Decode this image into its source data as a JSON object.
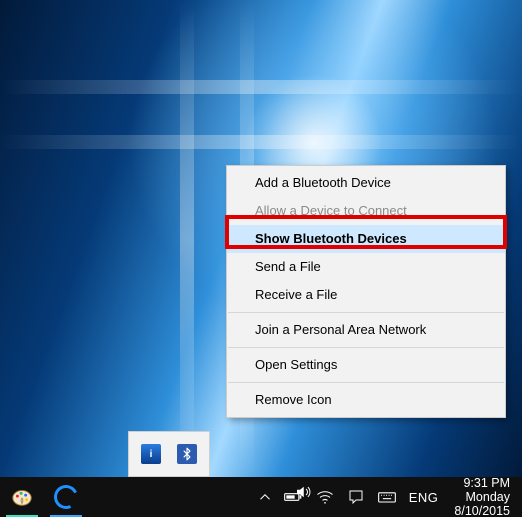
{
  "tray_popup": {
    "items": [
      {
        "name": "intel-graphics-icon",
        "glyph": "i"
      },
      {
        "name": "bluetooth-icon",
        "glyph": "฿"
      }
    ]
  },
  "context_menu": {
    "groups": [
      [
        {
          "label": "Add a Bluetooth Device",
          "disabled": false,
          "highlight": false,
          "name": "menu-add-device"
        },
        {
          "label": "Allow a Device to Connect",
          "disabled": true,
          "highlight": false,
          "name": "menu-allow-connect"
        },
        {
          "label": "Show Bluetooth Devices",
          "disabled": false,
          "highlight": true,
          "name": "menu-show-devices"
        },
        {
          "label": "Send a File",
          "disabled": false,
          "highlight": false,
          "name": "menu-send-file"
        },
        {
          "label": "Receive a File",
          "disabled": false,
          "highlight": false,
          "name": "menu-receive-file"
        }
      ],
      [
        {
          "label": "Join a Personal Area Network",
          "disabled": false,
          "highlight": false,
          "name": "menu-join-pan"
        }
      ],
      [
        {
          "label": "Open Settings",
          "disabled": false,
          "highlight": false,
          "name": "menu-open-settings"
        }
      ],
      [
        {
          "label": "Remove Icon",
          "disabled": false,
          "highlight": false,
          "name": "menu-remove-icon"
        }
      ]
    ]
  },
  "taskbar": {
    "pinned": [
      {
        "name": "paint-app",
        "icon": "paint"
      },
      {
        "name": "edge-app",
        "icon": "edge"
      }
    ],
    "tray_toggle": "chevron-up-icon",
    "tray": {
      "battery": "battery-icon",
      "wifi": "wifi-icon",
      "speaker": "speaker-icon",
      "action_center": "action-center-icon",
      "keyboard": "keyboard-icon",
      "lang": "ENG",
      "time": "9:31 PM",
      "day": "Monday",
      "date": "8/10/2015"
    }
  },
  "colors": {
    "menu_bg": "#f2f2f2",
    "menu_highlight": "#cde8ff",
    "taskbar_bg": "#101010",
    "accent": "#3da5ff",
    "annotation_red": "#e00000"
  }
}
